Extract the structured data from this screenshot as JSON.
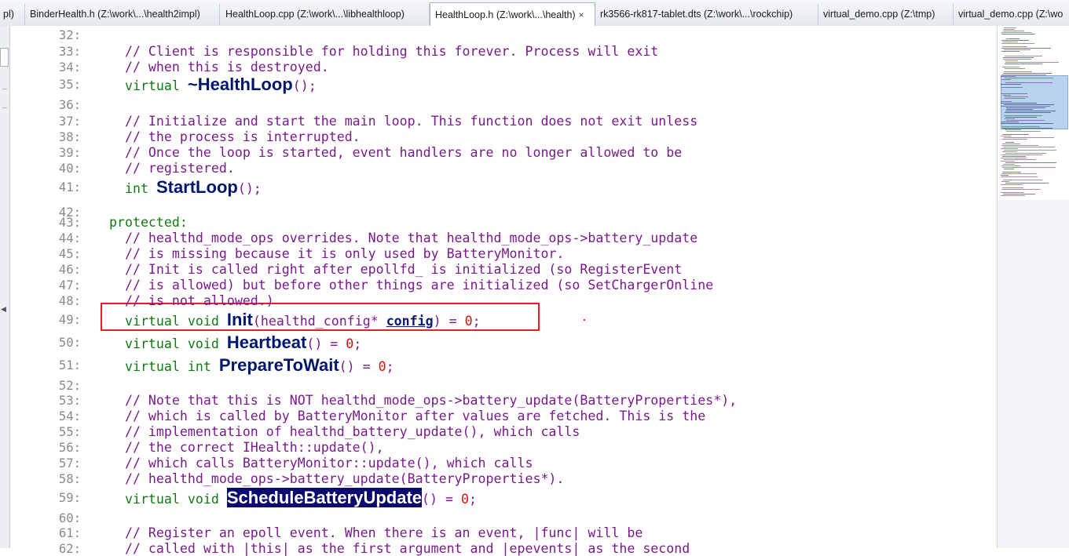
{
  "tabs": [
    {
      "label": "pl)"
    },
    {
      "label": "BinderHealth.h (Z:\\work\\...\\health2impl)"
    },
    {
      "label": "HealthLoop.cpp (Z:\\work\\...\\libhealthloop)"
    },
    {
      "label": "HealthLoop.h (Z:\\work\\...\\health)",
      "active": true,
      "close": "×"
    },
    {
      "label": "rk3566-rk817-tablet.dts (Z:\\work\\...\\rockchip)"
    },
    {
      "label": "virtual_demo.cpp (Z:\\tmp)"
    },
    {
      "label": "virtual_demo.cpp (Z:\\wo"
    }
  ],
  "code_lines": [
    {
      "n": "32:"
    },
    {
      "n": "33:",
      "c": "    // Client is responsible for holding this forever. Process will exit"
    },
    {
      "n": "34:",
      "c": "    // when this is destroyed."
    },
    {
      "n": "35:",
      "kw": "    virtual ",
      "fn": "~HealthLoop",
      "rest": "();"
    },
    {
      "n": "36:"
    },
    {
      "n": "37:",
      "c": "    // Initialize and start the main loop. This function does not exit unless"
    },
    {
      "n": "38:",
      "c": "    // the process is interrupted."
    },
    {
      "n": "39:",
      "c": "    // Once the loop is started, event handlers are no longer allowed to be"
    },
    {
      "n": "40:",
      "c": "    // registered."
    },
    {
      "n": "41:",
      "kw": "    int ",
      "fn": "StartLoop",
      "rest": "();"
    },
    {
      "n": "42:"
    },
    {
      "n": "43:",
      "kw": "  protected:"
    },
    {
      "n": "44:",
      "c": "    // healthd_mode_ops overrides. Note that healthd_mode_ops->battery_update"
    },
    {
      "n": "45:",
      "c": "    // is missing because it is only used by BatteryMonitor."
    },
    {
      "n": "46:",
      "c": "    // Init is called right after epollfd_ is initialized (so RegisterEvent"
    },
    {
      "n": "47:",
      "c": "    // is allowed) but before other things are initialized (so SetChargerOnline"
    },
    {
      "n": "48:",
      "c": "    // is not allowed.)"
    },
    {
      "n": "49:",
      "kw": "    virtual void ",
      "fn": "Init",
      "p1": "(healthd_config* ",
      "prm": "config",
      "p2": ") = ",
      "num": "0",
      "end": ";"
    },
    {
      "n": "50:",
      "kw": "    virtual void ",
      "fn": "Heartbeat",
      "p1": "() = ",
      "num": "0",
      "end": ";"
    },
    {
      "n": "51:",
      "kw": "    virtual int ",
      "fn": "PrepareToWait",
      "p1": "() = ",
      "num": "0",
      "end": ";"
    },
    {
      "n": "52:"
    },
    {
      "n": "53:",
      "c": "    // Note that this is NOT healthd_mode_ops->battery_update(BatteryProperties*),"
    },
    {
      "n": "54:",
      "c": "    // which is called by BatteryMonitor after values are fetched. This is the"
    },
    {
      "n": "55:",
      "c": "    // implementation of healthd_battery_update(), which calls"
    },
    {
      "n": "56:",
      "c": "    // the correct IHealth::update(),"
    },
    {
      "n": "57:",
      "c": "    // which calls BatteryMonitor::update(), which calls"
    },
    {
      "n": "58:",
      "c": "    // healthd_mode_ops->battery_update(BatteryProperties*)."
    },
    {
      "n": "59:",
      "kw": "    virtual void ",
      "fnsel": "ScheduleBatteryUpdate",
      "p1": "() = ",
      "num": "0",
      "end": ";"
    },
    {
      "n": "60:"
    },
    {
      "n": "61:",
      "c": "    // Register an epoll event. When there is an event, |func| will be"
    },
    {
      "n": "62:",
      "c": "    // called with |this| as the first argument and |epevents| as the second"
    }
  ],
  "colors": {
    "comment": "#7a1a8c",
    "keyword": "#127a12",
    "function": "#00166e",
    "number": "#d41010",
    "highlight_box": "#e0202a",
    "selection": "#0a0a6e"
  },
  "icons": {
    "left_arrow": "triangle-left-icon",
    "close": "close-icon"
  }
}
